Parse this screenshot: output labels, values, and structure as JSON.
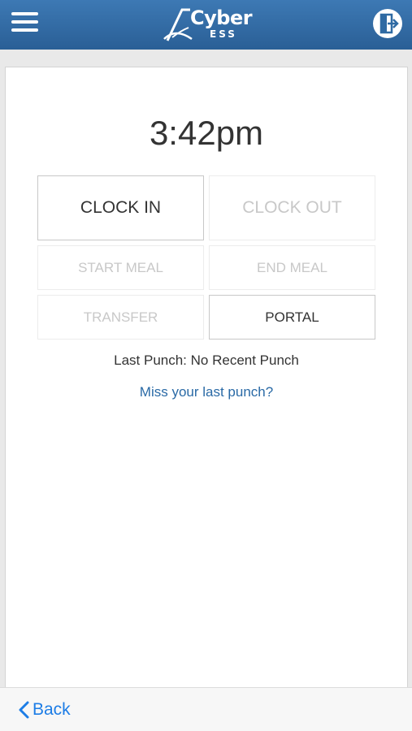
{
  "header": {
    "logo_text": "Cyber",
    "logo_sub": "ESS"
  },
  "time": "3:42pm",
  "punch_buttons": {
    "clock_in": "CLOCK IN",
    "clock_out": "CLOCK OUT",
    "start_meal": "START MEAL",
    "end_meal": "END MEAL",
    "transfer": "TRANSFER",
    "portal": "PORTAL"
  },
  "last_punch": "Last Punch: No Recent Punch",
  "miss_link": "Miss your last punch?",
  "footer": {
    "back_label": "Back"
  },
  "colors": {
    "header_blue": "#2f6aa3",
    "link_blue": "#2a6aa6",
    "back_blue": "#1d7de6",
    "disabled_text": "#c8c8c8"
  }
}
